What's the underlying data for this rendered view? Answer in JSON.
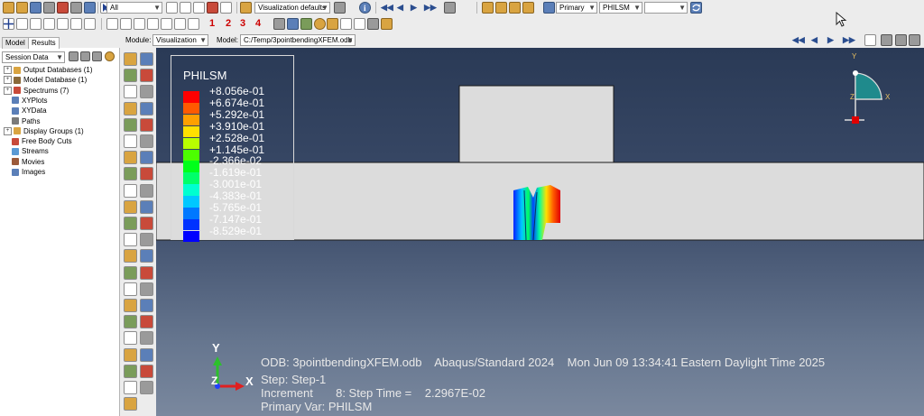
{
  "toolbar": {
    "filter_combo": "All",
    "visualization_defaults": "Visualization defaults",
    "partition_numbers": [
      "1",
      "2",
      "3",
      "4"
    ],
    "primary_combo": "Primary",
    "variable_combo": "PHILSM",
    "blank_combo": ""
  },
  "module_bar": {
    "module_label": "Module:",
    "module_value": "Visualization",
    "model_label": "Model:",
    "model_value": "C:/Temp/3pointbendingXFEM.odb"
  },
  "left_panel": {
    "tabs": [
      "Model",
      "Results"
    ],
    "session_combo": "Session Data",
    "tree": [
      {
        "label": "Output Databases (1)",
        "expandable": true,
        "color": "#d9a441"
      },
      {
        "label": "Model Database (1)",
        "expandable": true,
        "color": "#8a6a3a"
      },
      {
        "label": "Spectrums (7)",
        "expandable": true,
        "color": "#c84a3a"
      },
      {
        "label": "XYPlots",
        "expandable": false,
        "color": "#5b7fb8"
      },
      {
        "label": "XYData",
        "expandable": false,
        "color": "#5b7fb8"
      },
      {
        "label": "Paths",
        "expandable": false,
        "color": "#7a7a7a"
      },
      {
        "label": "Display Groups (1)",
        "expandable": true,
        "color": "#d9a441"
      },
      {
        "label": "Free Body Cuts",
        "expandable": false,
        "color": "#c84a3a"
      },
      {
        "label": "Streams",
        "expandable": false,
        "color": "#5b9ad4"
      },
      {
        "label": "Movies",
        "expandable": false,
        "color": "#9b5a3a"
      },
      {
        "label": "Images",
        "expandable": false,
        "color": "#5b7fb8"
      }
    ]
  },
  "legend": {
    "title": "PHILSM",
    "entries": [
      {
        "label": "+8.056e-01",
        "color": "#ff0000"
      },
      {
        "label": "+6.674e-01",
        "color": "#ff5a00"
      },
      {
        "label": "+5.292e-01",
        "color": "#ffa000"
      },
      {
        "label": "+3.910e-01",
        "color": "#ffe000"
      },
      {
        "label": "+2.528e-01",
        "color": "#b8ff00"
      },
      {
        "label": "+1.145e-01",
        "color": "#4cff00"
      },
      {
        "label": "-2.366e-02",
        "color": "#00ff1a"
      },
      {
        "label": "-1.619e-01",
        "color": "#00ff6a"
      },
      {
        "label": "-3.001e-01",
        "color": "#00ffd0"
      },
      {
        "label": "-4.383e-01",
        "color": "#00c8ff"
      },
      {
        "label": "-5.765e-01",
        "color": "#0078ff"
      },
      {
        "label": "-7.147e-01",
        "color": "#0032ff"
      },
      {
        "label": "-8.529e-01",
        "color": ""
      }
    ]
  },
  "triad_small": {
    "y": "Y",
    "z": "Z",
    "x": "X"
  },
  "triad_large": {
    "y": "Y",
    "z": "Z",
    "x": "X"
  },
  "info_text": {
    "odb": "ODB: 3pointbendingXFEM.odb    Abaqus/Standard 2024    Mon Jun 09 13:34:41 Eastern Daylight Time 2025",
    "step": "Step: Step-1",
    "increment": "Increment       8: Step Time =    2.2967E-02",
    "primary_var": "Primary Var: PHILSM"
  },
  "colors": {
    "viewport_top": "#2a3a56",
    "viewport_bottom": "#7a889e",
    "beam": "#dcdcdc",
    "legend_last": "#0000ff"
  }
}
